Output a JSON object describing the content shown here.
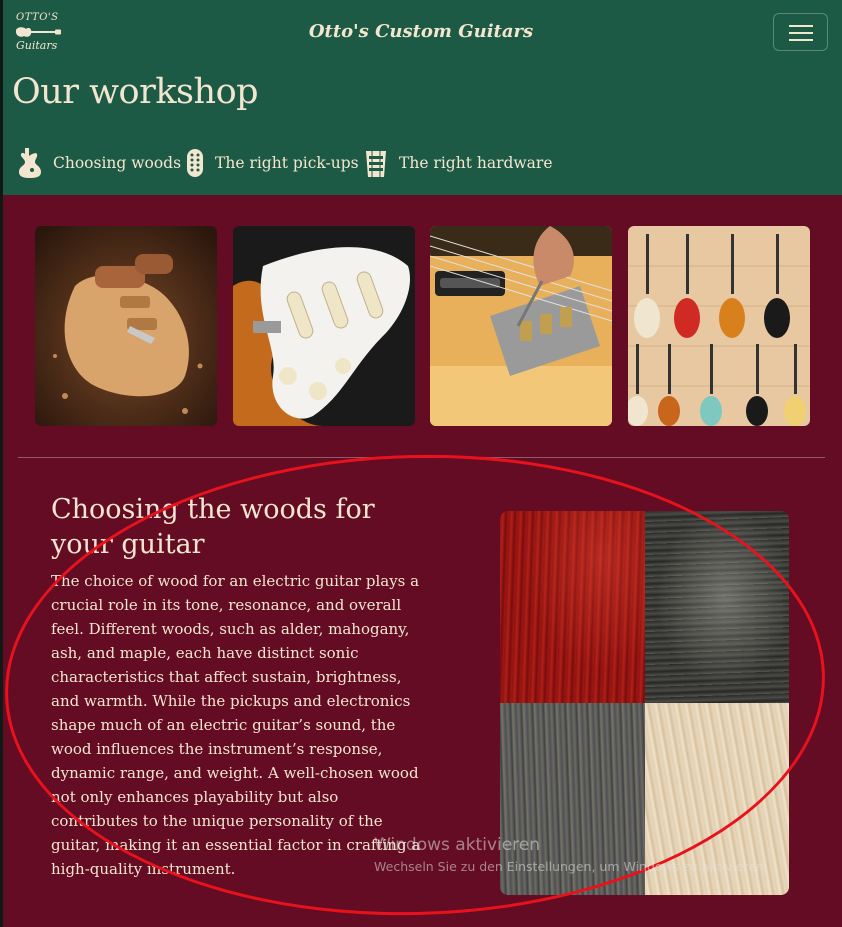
{
  "header": {
    "logo_line1": "OTTO'S",
    "logo_line2": "Guitars",
    "brand": "Otto's Custom Guitars",
    "menu_button": "toggle navigation"
  },
  "page": {
    "title": "Our workshop"
  },
  "nav": {
    "items": [
      {
        "label": "Choosing woods",
        "icon": "guitar-body-icon"
      },
      {
        "label": "The right pick-ups",
        "icon": "pickup-icon"
      },
      {
        "label": "The right hardware",
        "icon": "bridge-icon"
      }
    ]
  },
  "gallery": {
    "items": [
      {
        "name": "carving-guitar-body-photo"
      },
      {
        "name": "pickguard-pickups-photo"
      },
      {
        "name": "bridge-adjustment-photo"
      },
      {
        "name": "guitar-wall-photo"
      }
    ]
  },
  "section": {
    "title": "Choosing the woods for your guitar",
    "text": "The choice of wood for an electric guitar plays a crucial role in its tone, resonance, and overall feel. Different woods, such as alder, mahogany, ash, and maple, each have distinct sonic characteristics that affect sustain, brightness, and warmth. While the pickups and electronics shape much of an electric guitar’s sound, the wood influences the instrument’s response, dynamic range, and weight. A well-chosen wood not only enhances playability but also contributes to the unique personality of the guitar, making it an essential factor in crafting a high-quality instrument."
  },
  "overlay": {
    "watermark_title": "Windows aktivieren",
    "watermark_text": "Wechseln Sie zu den Einstellungen, um Windows zu aktivieren."
  },
  "colors": {
    "header_bg": "#1d5a45",
    "body_bg": "#640c24",
    "text": "#f3e6d0",
    "annotation": "#e8121c"
  }
}
